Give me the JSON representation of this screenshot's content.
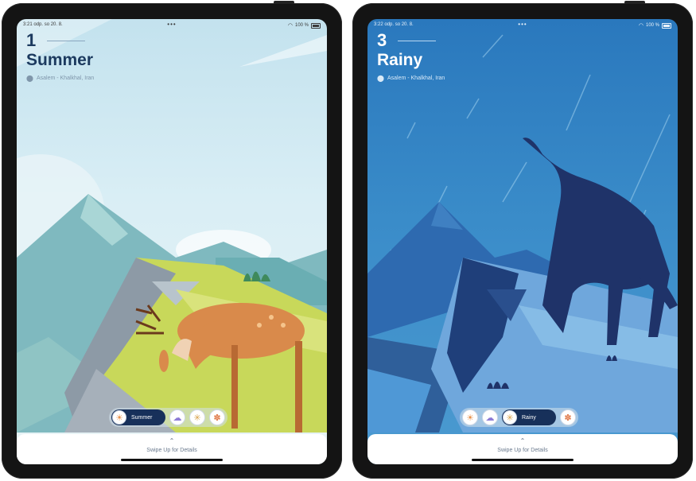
{
  "colors": {
    "summer_sky_top": "#c9e4ef",
    "summer_text": "#1c3a5f",
    "rainy_sky_top": "#2f7ec0",
    "rainy_text": "#ffffff",
    "pill_bg": "#17305a"
  },
  "screens": {
    "summer": {
      "status_time": "3:21 odp.  so 20. 8.",
      "status_dots": "•••",
      "status_battery": "100 %",
      "number": "1",
      "season": "Summer",
      "location": "Asalem - Khalkhal, Iran",
      "selected_label": "Summer",
      "swipe_hint": "Swipe Up for Details",
      "caret": "⌃"
    },
    "rainy": {
      "status_time": "3:22 odp.  so 20. 8.",
      "status_dots": "•••",
      "status_battery": "100 %",
      "number": "3",
      "season": "Rainy",
      "location": "Asalem - Khalkhal, Iran",
      "selected_label": "Rainy",
      "swipe_hint": "Swipe Up for Details",
      "caret": "⌃"
    }
  },
  "icons": [
    "sun-cloud-icon",
    "rain-cloud-icon",
    "snowflake-icon",
    "autumn-leaf-icon",
    "location-pin-icon",
    "wifi-icon",
    "battery-icon"
  ]
}
